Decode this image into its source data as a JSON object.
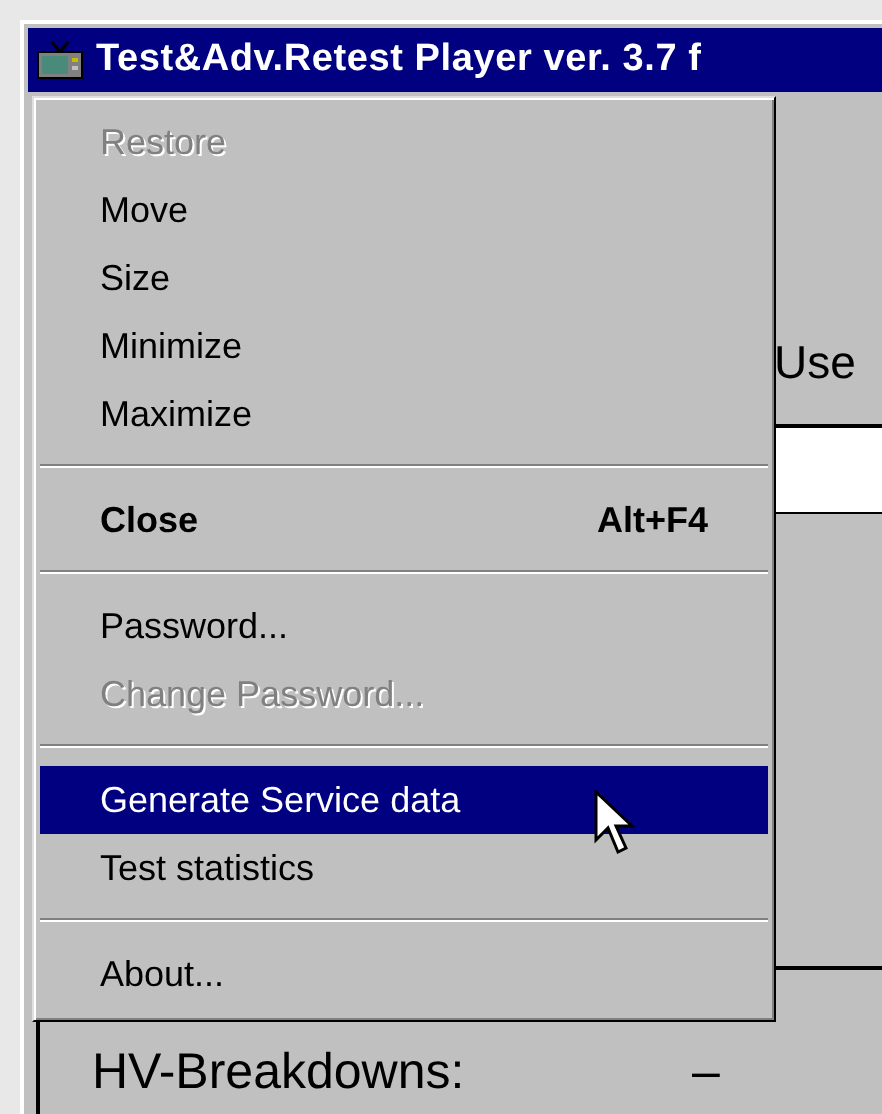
{
  "window": {
    "title": "Test&Adv.Retest Player ver. 3.7 f"
  },
  "content": {
    "user_label": "Use",
    "panel_rows": [
      {
        "label": "HV-Breakdowns:",
        "value": "–"
      }
    ]
  },
  "system_menu": {
    "items": [
      {
        "kind": "item",
        "label": "Restore",
        "disabled": true,
        "selected": false
      },
      {
        "kind": "item",
        "label": "Move",
        "disabled": false,
        "selected": false
      },
      {
        "kind": "item",
        "label": "Size",
        "disabled": false,
        "selected": false
      },
      {
        "kind": "item",
        "label": "Minimize",
        "disabled": false,
        "selected": false
      },
      {
        "kind": "item",
        "label": "Maximize",
        "disabled": false,
        "selected": false
      },
      {
        "kind": "separator"
      },
      {
        "kind": "item",
        "label": "Close",
        "shortcut": "Alt+F4",
        "bold": true,
        "disabled": false,
        "selected": false
      },
      {
        "kind": "separator"
      },
      {
        "kind": "item",
        "label": "Password...",
        "disabled": false,
        "selected": false
      },
      {
        "kind": "item",
        "label": "Change Password...",
        "disabled": true,
        "selected": false
      },
      {
        "kind": "separator"
      },
      {
        "kind": "item",
        "label": "Generate Service data",
        "disabled": false,
        "selected": true
      },
      {
        "kind": "item",
        "label": "Test statistics",
        "disabled": false,
        "selected": false
      },
      {
        "kind": "separator"
      },
      {
        "kind": "item",
        "label": "About...",
        "disabled": false,
        "selected": false
      }
    ]
  }
}
